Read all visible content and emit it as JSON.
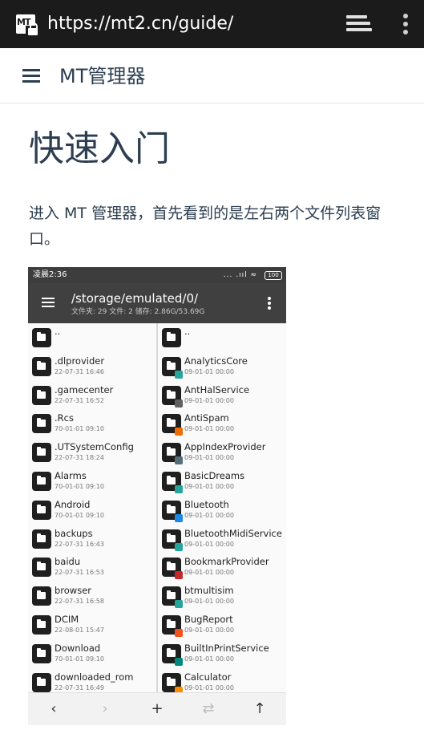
{
  "browser": {
    "url": "https://mt2.cn/guide/",
    "site_icon_text": "MT"
  },
  "navbar": {
    "title": "MT管理器"
  },
  "content": {
    "heading": "快速入门",
    "paragraph": "进入 MT 管理器，首先看到的是左右两个文件列表窗口。"
  },
  "screenshot": {
    "status_time": "凌晨2:36",
    "status_signal": "... .ııl ≈",
    "battery": "100",
    "path": "/storage/emulated/0/",
    "path_info": "文件夹: 29  文件: 2  储存: 2.86G/53.69G",
    "left_files": [
      {
        "name": "..",
        "date": ""
      },
      {
        "name": ".dlprovider",
        "date": "22-07-31 16:46"
      },
      {
        "name": ".gamecenter",
        "date": "22-07-31 16:52"
      },
      {
        "name": ".Rcs",
        "date": "70-01-01 09:10"
      },
      {
        "name": ".UTSystemConfig",
        "date": "22-07-31 18:24"
      },
      {
        "name": "Alarms",
        "date": "70-01-01 09:10"
      },
      {
        "name": "Android",
        "date": "70-01-01 09:10"
      },
      {
        "name": "backups",
        "date": "22-07-31 16:43"
      },
      {
        "name": "baidu",
        "date": "22-07-31 16:53"
      },
      {
        "name": "browser",
        "date": "22-07-31 16:58"
      },
      {
        "name": "DCIM",
        "date": "22-08-01 15:47"
      },
      {
        "name": "Download",
        "date": "70-01-01 09:10"
      },
      {
        "name": "downloaded_rom",
        "date": "22-07-31 16:49"
      }
    ],
    "right_files": [
      {
        "name": "..",
        "date": "",
        "badge": ""
      },
      {
        "name": "AnalyticsCore",
        "date": "09-01-01 00:00",
        "badge": "#26a69a"
      },
      {
        "name": "AntHalService",
        "date": "09-01-01 00:00",
        "badge": "#616161"
      },
      {
        "name": "AntiSpam",
        "date": "09-01-01 00:00",
        "badge": "#ef6c00"
      },
      {
        "name": "AppIndexProvider",
        "date": "09-01-01 00:00",
        "badge": "#546e7a"
      },
      {
        "name": "BasicDreams",
        "date": "09-01-01 00:00",
        "badge": "#26a69a"
      },
      {
        "name": "Bluetooth",
        "date": "09-01-01 00:00",
        "badge": "#1e88e5"
      },
      {
        "name": "BluetoothMidiService",
        "date": "09-01-01 00:00",
        "badge": "#26a69a"
      },
      {
        "name": "BookmarkProvider",
        "date": "09-01-01 00:00",
        "badge": "#c62828"
      },
      {
        "name": "btmultisim",
        "date": "09-01-01 00:00",
        "badge": "#26a69a"
      },
      {
        "name": "BugReport",
        "date": "09-01-01 00:00",
        "badge": "#f4511e"
      },
      {
        "name": "BuiltInPrintService",
        "date": "09-01-01 00:00",
        "badge": "#00897b"
      },
      {
        "name": "Calculator",
        "date": "09-01-01 00:00",
        "badge": "#fb8c00"
      }
    ],
    "bottom_buttons": [
      {
        "icon": "‹",
        "name": "back-icon",
        "dim": false
      },
      {
        "icon": "›",
        "name": "forward-icon",
        "dim": true
      },
      {
        "icon": "+",
        "name": "add-icon",
        "dim": false
      },
      {
        "icon": "⇄",
        "name": "swap-icon",
        "dim": true
      },
      {
        "icon": "↑",
        "name": "up-icon",
        "dim": false
      }
    ]
  }
}
